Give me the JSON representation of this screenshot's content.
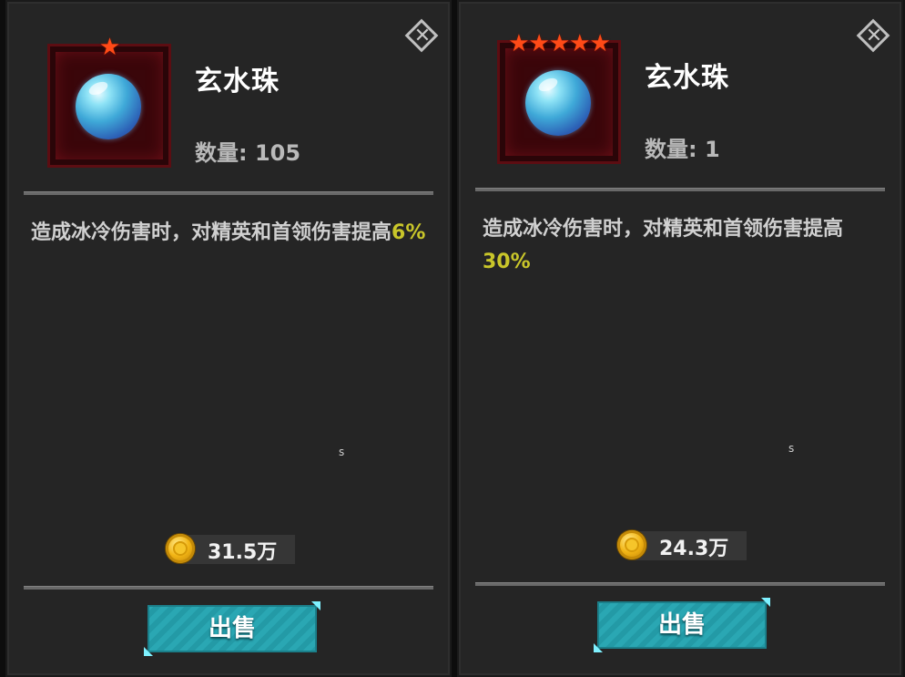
{
  "panels": [
    {
      "stars": "★",
      "item_name": "玄水珠",
      "quantity": "数量: 105",
      "description_text": "造成冰冷伤害时，对精英和首领伤害提高",
      "description_value": "6%",
      "marker": "s",
      "price": "31.5万",
      "sell_label": "出售",
      "close_symbol": "✕"
    },
    {
      "stars": "★★★★★",
      "item_name": "玄水珠",
      "quantity": "数量: 1",
      "description_text": "造成冰冷伤害时，对精英和首领伤害提高",
      "description_value": "30%",
      "marker": "s",
      "price": "24.3万",
      "sell_label": "出售",
      "close_symbol": "✕"
    }
  ],
  "colors": {
    "highlight": "#c9c62a",
    "button": "#2aa7b3",
    "frame": "#3a060a",
    "star": "#ff4a17"
  },
  "icons": [
    "close-icon",
    "star-icon",
    "orb-icon",
    "coin-icon"
  ]
}
